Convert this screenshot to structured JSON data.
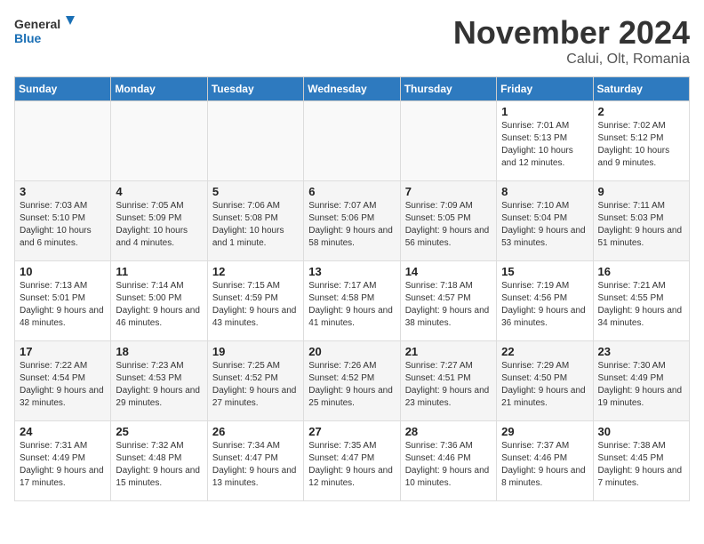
{
  "header": {
    "logo_line1": "General",
    "logo_line2": "Blue",
    "month_title": "November 2024",
    "location": "Calui, Olt, Romania"
  },
  "weekdays": [
    "Sunday",
    "Monday",
    "Tuesday",
    "Wednesday",
    "Thursday",
    "Friday",
    "Saturday"
  ],
  "weeks": [
    [
      {
        "day": "",
        "info": ""
      },
      {
        "day": "",
        "info": ""
      },
      {
        "day": "",
        "info": ""
      },
      {
        "day": "",
        "info": ""
      },
      {
        "day": "",
        "info": ""
      },
      {
        "day": "1",
        "info": "Sunrise: 7:01 AM\nSunset: 5:13 PM\nDaylight: 10 hours and 12 minutes."
      },
      {
        "day": "2",
        "info": "Sunrise: 7:02 AM\nSunset: 5:12 PM\nDaylight: 10 hours and 9 minutes."
      }
    ],
    [
      {
        "day": "3",
        "info": "Sunrise: 7:03 AM\nSunset: 5:10 PM\nDaylight: 10 hours and 6 minutes."
      },
      {
        "day": "4",
        "info": "Sunrise: 7:05 AM\nSunset: 5:09 PM\nDaylight: 10 hours and 4 minutes."
      },
      {
        "day": "5",
        "info": "Sunrise: 7:06 AM\nSunset: 5:08 PM\nDaylight: 10 hours and 1 minute."
      },
      {
        "day": "6",
        "info": "Sunrise: 7:07 AM\nSunset: 5:06 PM\nDaylight: 9 hours and 58 minutes."
      },
      {
        "day": "7",
        "info": "Sunrise: 7:09 AM\nSunset: 5:05 PM\nDaylight: 9 hours and 56 minutes."
      },
      {
        "day": "8",
        "info": "Sunrise: 7:10 AM\nSunset: 5:04 PM\nDaylight: 9 hours and 53 minutes."
      },
      {
        "day": "9",
        "info": "Sunrise: 7:11 AM\nSunset: 5:03 PM\nDaylight: 9 hours and 51 minutes."
      }
    ],
    [
      {
        "day": "10",
        "info": "Sunrise: 7:13 AM\nSunset: 5:01 PM\nDaylight: 9 hours and 48 minutes."
      },
      {
        "day": "11",
        "info": "Sunrise: 7:14 AM\nSunset: 5:00 PM\nDaylight: 9 hours and 46 minutes."
      },
      {
        "day": "12",
        "info": "Sunrise: 7:15 AM\nSunset: 4:59 PM\nDaylight: 9 hours and 43 minutes."
      },
      {
        "day": "13",
        "info": "Sunrise: 7:17 AM\nSunset: 4:58 PM\nDaylight: 9 hours and 41 minutes."
      },
      {
        "day": "14",
        "info": "Sunrise: 7:18 AM\nSunset: 4:57 PM\nDaylight: 9 hours and 38 minutes."
      },
      {
        "day": "15",
        "info": "Sunrise: 7:19 AM\nSunset: 4:56 PM\nDaylight: 9 hours and 36 minutes."
      },
      {
        "day": "16",
        "info": "Sunrise: 7:21 AM\nSunset: 4:55 PM\nDaylight: 9 hours and 34 minutes."
      }
    ],
    [
      {
        "day": "17",
        "info": "Sunrise: 7:22 AM\nSunset: 4:54 PM\nDaylight: 9 hours and 32 minutes."
      },
      {
        "day": "18",
        "info": "Sunrise: 7:23 AM\nSunset: 4:53 PM\nDaylight: 9 hours and 29 minutes."
      },
      {
        "day": "19",
        "info": "Sunrise: 7:25 AM\nSunset: 4:52 PM\nDaylight: 9 hours and 27 minutes."
      },
      {
        "day": "20",
        "info": "Sunrise: 7:26 AM\nSunset: 4:52 PM\nDaylight: 9 hours and 25 minutes."
      },
      {
        "day": "21",
        "info": "Sunrise: 7:27 AM\nSunset: 4:51 PM\nDaylight: 9 hours and 23 minutes."
      },
      {
        "day": "22",
        "info": "Sunrise: 7:29 AM\nSunset: 4:50 PM\nDaylight: 9 hours and 21 minutes."
      },
      {
        "day": "23",
        "info": "Sunrise: 7:30 AM\nSunset: 4:49 PM\nDaylight: 9 hours and 19 minutes."
      }
    ],
    [
      {
        "day": "24",
        "info": "Sunrise: 7:31 AM\nSunset: 4:49 PM\nDaylight: 9 hours and 17 minutes."
      },
      {
        "day": "25",
        "info": "Sunrise: 7:32 AM\nSunset: 4:48 PM\nDaylight: 9 hours and 15 minutes."
      },
      {
        "day": "26",
        "info": "Sunrise: 7:34 AM\nSunset: 4:47 PM\nDaylight: 9 hours and 13 minutes."
      },
      {
        "day": "27",
        "info": "Sunrise: 7:35 AM\nSunset: 4:47 PM\nDaylight: 9 hours and 12 minutes."
      },
      {
        "day": "28",
        "info": "Sunrise: 7:36 AM\nSunset: 4:46 PM\nDaylight: 9 hours and 10 minutes."
      },
      {
        "day": "29",
        "info": "Sunrise: 7:37 AM\nSunset: 4:46 PM\nDaylight: 9 hours and 8 minutes."
      },
      {
        "day": "30",
        "info": "Sunrise: 7:38 AM\nSunset: 4:45 PM\nDaylight: 9 hours and 7 minutes."
      }
    ]
  ]
}
